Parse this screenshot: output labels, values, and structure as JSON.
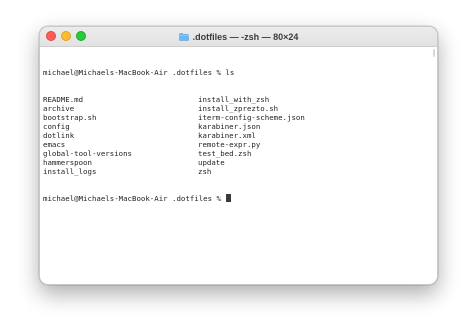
{
  "window": {
    "title": ".dotfiles — -zsh — 80×24",
    "folder_icon": "folder-icon"
  },
  "terminal": {
    "prompt_command": "michael@Michaels-MacBook-Air .dotfiles % ls",
    "listing": [
      [
        "README.md",
        "install_with_zsh"
      ],
      [
        "archive",
        "install_zprezto.sh"
      ],
      [
        "bootstrap.sh",
        "iterm-config-scheme.json"
      ],
      [
        "config",
        "karabiner.json"
      ],
      [
        "dotlink",
        "karabiner.xml"
      ],
      [
        "emacs",
        "remote-expr.py"
      ],
      [
        "global-tool-versions",
        "test_bed.zsh"
      ],
      [
        "hammerspoon",
        "update"
      ],
      [
        "install_logs",
        "zsh"
      ]
    ],
    "current_prompt": "michael@Michaels-MacBook-Air .dotfiles % "
  },
  "colors": {
    "close": "#fe5f57",
    "minimize": "#febc2e",
    "maximize": "#28c840",
    "folder": "#6cb6f2"
  }
}
